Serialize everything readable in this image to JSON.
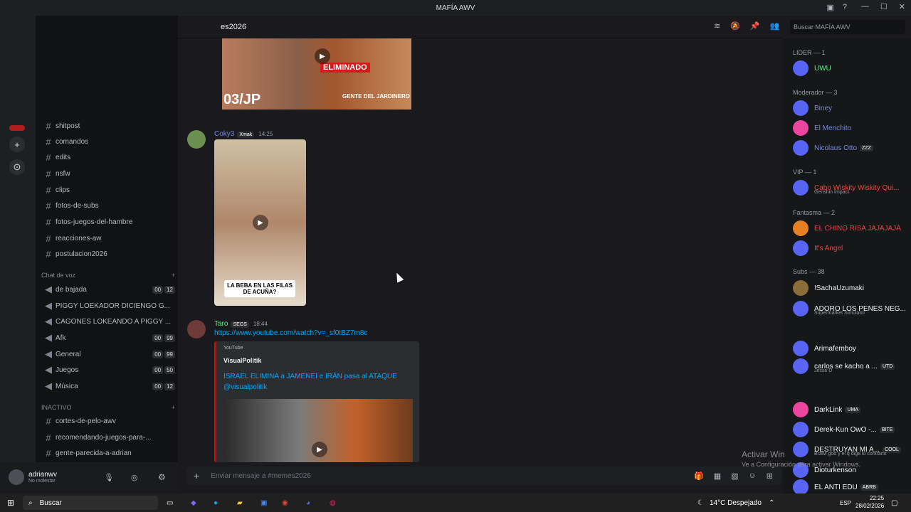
{
  "window": {
    "title": "MAFÍA AWV"
  },
  "channel": {
    "name": "memes2026",
    "name_display": "es2026",
    "search_placeholder": "Buscar MAFÍA AWV",
    "composer_placeholder": "Enviar mensaje a #memes2026"
  },
  "channels": {
    "text": [
      "shitpost",
      "comandos",
      "edits",
      "nsfw",
      "clips",
      "fotos-de-subs",
      "fotos-juegos-del-hambre",
      "reacciones-aw",
      "postulacion2026"
    ],
    "voice_category": "Chat de voz",
    "voice": [
      {
        "label": "de bajada",
        "a": "00",
        "b": "12"
      },
      {
        "label": "PIGGY LOEKADOR DICIENGO G...",
        "a": "",
        "b": ""
      },
      {
        "label": "CAGONES LOKEANDO A PIGGY ...",
        "a": "",
        "b": ""
      },
      {
        "label": "Afk",
        "a": "00",
        "b": "99"
      },
      {
        "label": "General",
        "a": "00",
        "b": "99"
      },
      {
        "label": "Juegos",
        "a": "00",
        "b": "50"
      },
      {
        "label": "Música",
        "a": "00",
        "b": "12"
      }
    ],
    "inactive_category": "INACTIVO",
    "inactive": [
      "cortes-de-pelo-awv",
      "recomendando-juegos-para-...",
      "gente-parecida-a-adrian"
    ]
  },
  "user": {
    "name": "adrianwv",
    "status": "No molestar"
  },
  "messages": {
    "thumb1": {
      "text1": "03/JP",
      "text2": "ELIMINADO",
      "text3": "GENTE DEL JARDINERO",
      "text4": "JARDINERO"
    },
    "m1": {
      "author": "Coky3",
      "tag": "Xmak",
      "time": "14:25",
      "caption": "LA BEBA EN LAS FILAS DE ACUÑA?"
    },
    "m2": {
      "author": "Taro",
      "tag": "SEGS",
      "time": "18:44",
      "link": "https://www.youtube.com/watch?v=_sf0tBZ7m8c",
      "embed_provider": "YouTube",
      "embed_author": "VisualPolitik",
      "embed_title": "ISRAEL ELIMINA a JAMENEI e IRÁN pasa al ATAQUE @visualpolitik"
    }
  },
  "members": {
    "groups": [
      {
        "title": "LIDER — 1",
        "items": [
          {
            "name": "UWU",
            "color": "#57f287"
          }
        ]
      },
      {
        "title": "Moderador — 3",
        "items": [
          {
            "name": "Biney",
            "color": "#7289da"
          },
          {
            "name": "El Menchito",
            "color": "#7289da"
          },
          {
            "name": "Nicolaus Otto",
            "color": "#7289da",
            "tag": "ZZZ"
          }
        ]
      },
      {
        "title": "VIP — 1",
        "items": [
          {
            "name": "Cabo Wiskity Wiskity Qui...",
            "color": "#e74c3c",
            "sub": "Genshin Impact"
          }
        ]
      },
      {
        "title": "Fantasma — 2",
        "items": [
          {
            "name": "EL CHINO RISA JAJAJAJA",
            "color": "#ed4245"
          },
          {
            "name": "It's Angel",
            "color": "#ed4245"
          }
        ]
      },
      {
        "title": "Subs — 38",
        "items": [
          {
            "name": "!SachaUzumaki",
            "color": "#f2f3f5"
          },
          {
            "name": "ADORO LOS PENES NEG...",
            "color": "#f2f3f5",
            "sub": "Supermarket Simulator"
          },
          {
            "name": "Arimafemboy",
            "color": "#f2f3f5"
          },
          {
            "name": "carlos se kacho a ...",
            "color": "#f2f3f5",
            "tag": "UTD",
            "sub": "Jesse D"
          },
          {
            "name": "DarkLink",
            "color": "#f2f3f5",
            "tag": "UMA"
          },
          {
            "name": "Derek-Kun OwO -...",
            "color": "#f2f3f5",
            "tag": "BITE"
          },
          {
            "name": "DESTRUYAN MI A...",
            "color": "#f2f3f5",
            "tag": "COOL",
            "sub": "Brawl god y el q diga lo contrario"
          },
          {
            "name": "Dioturkenson",
            "color": "#f2f3f5"
          },
          {
            "name": "EL ANTI EDU",
            "color": "#f2f3f5",
            "tag": "ABRB"
          }
        ]
      }
    ]
  },
  "watermark": {
    "line1": "Activar Windows",
    "line1_display": "Activar Win",
    "line2": "Ve a Configuración para activar Windows."
  },
  "taskbar": {
    "search": "Buscar",
    "weather": "14°C  Despejado",
    "lang": "ESP",
    "time": "22:25",
    "date": "28/02/2026"
  }
}
